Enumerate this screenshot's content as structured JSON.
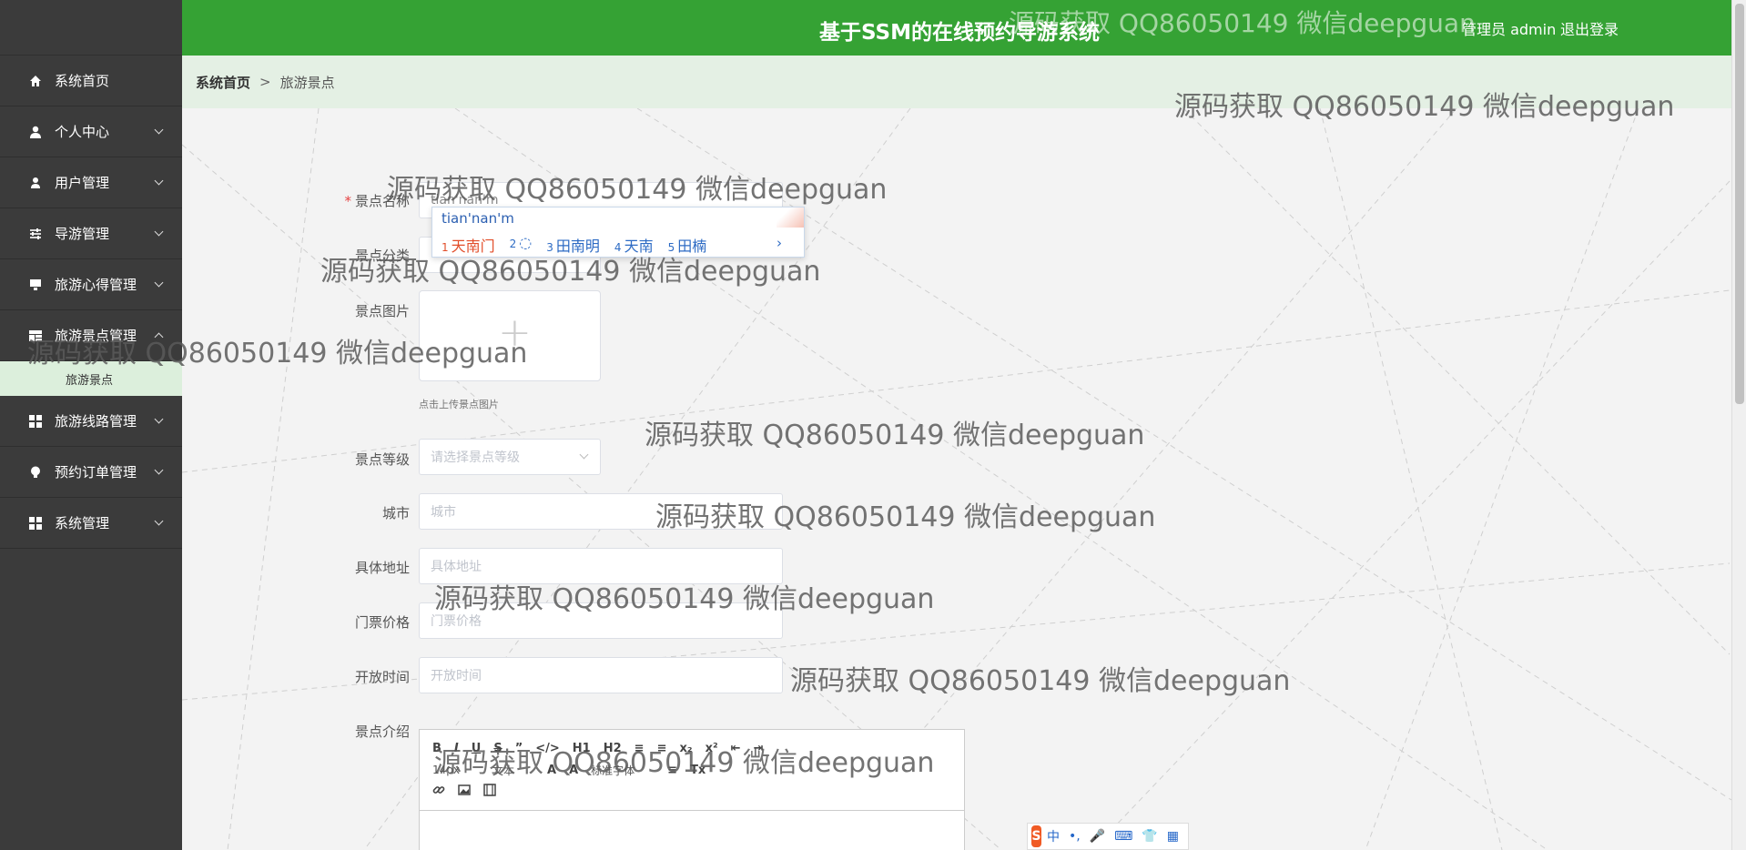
{
  "header": {
    "title": "基于SSM的在线预约导游系统",
    "user": "管理员 admin",
    "logout": "退出登录"
  },
  "sidebar": {
    "items": [
      {
        "label": "系统首页",
        "icon": "home-icon"
      },
      {
        "label": "个人中心",
        "icon": "user-icon"
      },
      {
        "label": "用户管理",
        "icon": "user-icon"
      },
      {
        "label": "导游管理",
        "icon": "sliders-icon"
      },
      {
        "label": "旅游心得管理",
        "icon": "monitor-icon"
      },
      {
        "label": "旅游景点管理",
        "icon": "layout-icon"
      },
      {
        "label": "旅游线路管理",
        "icon": "grid-icon"
      },
      {
        "label": "预约订单管理",
        "icon": "bulb-icon"
      },
      {
        "label": "系统管理",
        "icon": "grid-icon"
      }
    ],
    "submenu": {
      "label": "旅游景点"
    }
  },
  "breadcrumb": {
    "home": "系统首页",
    "sep": ">",
    "current": "旅游景点"
  },
  "form": {
    "name": {
      "label": "景点名称",
      "value": "tian'nan'm"
    },
    "category": {
      "label": "景点分类"
    },
    "image": {
      "label": "景点图片",
      "tip": "点击上传景点图片"
    },
    "level": {
      "label": "景点等级",
      "placeholder": "请选择景点等级"
    },
    "city": {
      "label": "城市",
      "placeholder": "城市"
    },
    "address": {
      "label": "具体地址",
      "placeholder": "具体地址"
    },
    "price": {
      "label": "门票价格",
      "placeholder": "门票价格"
    },
    "open_time": {
      "label": "开放时间",
      "placeholder": "开放时间"
    },
    "intro": {
      "label": "景点介绍"
    }
  },
  "ime": {
    "composition": "tian'nan'm",
    "candidates": [
      {
        "n": "1",
        "text": "天南门"
      },
      {
        "n": "2",
        "text": "◌"
      },
      {
        "n": "3",
        "text": "田南明"
      },
      {
        "n": "4",
        "text": "天南"
      },
      {
        "n": "5",
        "text": "田楠"
      }
    ],
    "next": "›"
  },
  "editor": {
    "row1": [
      "B",
      "I",
      "U",
      "S",
      "”",
      "</>",
      "H1",
      "H2",
      "≡",
      "≡",
      "x₂",
      "x²",
      "⇤",
      "⇥"
    ],
    "row2": [
      "14px",
      "文本",
      "A",
      "A",
      "标准字体",
      "≡",
      "Tx"
    ],
    "row3": [
      "link",
      "image",
      "video"
    ]
  },
  "sogou": {
    "logo": "S",
    "items": [
      "中",
      "•,",
      "🎤",
      "⌨",
      "👕",
      "▦"
    ]
  },
  "watermark": "源码获取 QQ86050149 微信deepguan",
  "colors": {
    "header": "#35a234",
    "sidebar": "#3b3b3b",
    "submenu": "#dcefdc",
    "breadcrumb": "#e4f0e4"
  }
}
